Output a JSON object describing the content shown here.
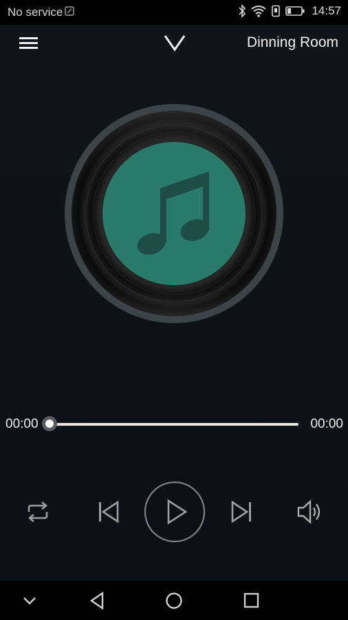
{
  "status_bar": {
    "carrier": "No service",
    "time": "14:57",
    "icons": [
      "sim-icon",
      "bluetooth-icon",
      "wifi-icon",
      "vibrate-icon",
      "battery-icon"
    ]
  },
  "header": {
    "menu_icon": "hamburger-menu-icon",
    "collapse_icon": "chevron-down-icon",
    "room_name": "Dinning Room"
  },
  "album_art": {
    "icon": "music-note-icon",
    "accent_color": "#2a7a6a"
  },
  "progress": {
    "elapsed": "00:00",
    "total": "00:00",
    "fraction": 0
  },
  "controls": {
    "repeat": "repeat-icon",
    "previous": "skip-previous-icon",
    "play": "play-icon",
    "next": "skip-next-icon",
    "volume": "volume-icon"
  },
  "nav_bar": {
    "items": [
      "hide-nav-icon",
      "back-icon",
      "home-icon",
      "recents-icon"
    ]
  }
}
